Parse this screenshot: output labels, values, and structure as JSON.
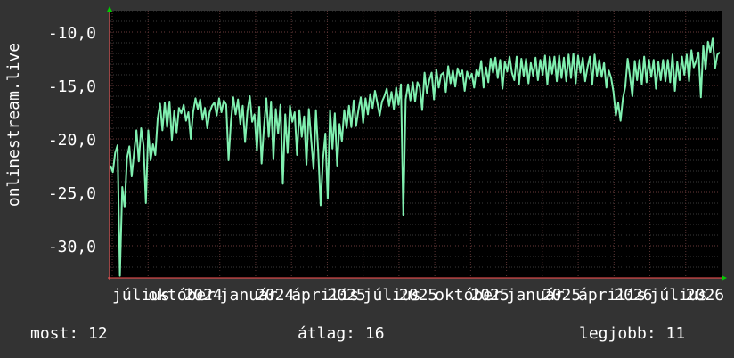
{
  "chart_data": {
    "type": "line",
    "ylabel": "onlinestream.live",
    "ylim": [
      -33,
      -8
    ],
    "yticks": [
      -10,
      -15,
      -20,
      -25,
      -30
    ],
    "ytick_labels": [
      "-10,0",
      "-15,0",
      "-20,0",
      "-25,0",
      "-30,0"
    ],
    "xtick_labels": [
      "július",
      "október",
      "2024",
      "január",
      "2024",
      "április",
      "2025",
      "július",
      "2025",
      "október",
      "2025",
      "január",
      "2025",
      "április",
      "2026",
      "július",
      "2026"
    ],
    "grid": true,
    "series": [
      {
        "color": "#80f0b0",
        "values": [
          -22.5,
          -23.1,
          -21.3,
          -20.6,
          -32.8,
          -24.5,
          -26.4,
          -21.8,
          -20.7,
          -23.5,
          -21.3,
          -19.2,
          -22.1,
          -19.0,
          -20.6,
          -26.0,
          -19.2,
          -22.0,
          -20.5,
          -21.5,
          -18.1,
          -16.7,
          -19.2,
          -16.6,
          -18.9,
          -16.5,
          -20.1,
          -17.4,
          -19.4,
          -17.1,
          -17.6,
          -16.8,
          -18.3,
          -17.5,
          -20.0,
          -17.5,
          -16.2,
          -17.2,
          -16.3,
          -18.2,
          -17.1,
          -19.0,
          -17.5,
          -16.9,
          -16.6,
          -17.8,
          -16.2,
          -17.5,
          -16.4,
          -16.8,
          -22.0,
          -18.4,
          -16.1,
          -17.7,
          -16.3,
          -18.6,
          -16.9,
          -20.3,
          -17.4,
          -16.0,
          -18.4,
          -17.7,
          -21.1,
          -17.0,
          -22.3,
          -18.9,
          -16.2,
          -19.8,
          -16.5,
          -21.9,
          -17.2,
          -19.5,
          -16.8,
          -24.2,
          -17.7,
          -21.3,
          -16.9,
          -18.4,
          -17.5,
          -21.5,
          -17.3,
          -19.8,
          -17.9,
          -22.4,
          -17.2,
          -20.1,
          -22.8,
          -17.3,
          -21.3,
          -26.2,
          -21.9,
          -19.5,
          -25.6,
          -17.3,
          -20.9,
          -17.6,
          -22.5,
          -18.6,
          -20.2,
          -17.3,
          -19.0,
          -16.9,
          -18.9,
          -16.4,
          -18.8,
          -17.3,
          -16.1,
          -18.5,
          -16.2,
          -17.7,
          -15.8,
          -17.1,
          -15.5,
          -16.6,
          -17.8,
          -16.5,
          -16.0,
          -15.3,
          -16.9,
          -15.6,
          -17.2,
          -15.2,
          -16.8,
          -14.9,
          -27.1,
          -16.3,
          -14.9,
          -16.4,
          -14.7,
          -16.5,
          -14.7,
          -15.2,
          -17.3,
          -13.8,
          -15.7,
          -14.5,
          -13.8,
          -16.3,
          -13.5,
          -15.2,
          -14.0,
          -13.8,
          -15.6,
          -13.2,
          -14.8,
          -13.6,
          -15.1,
          -13.4,
          -14.1,
          -13.6,
          -15.5,
          -13.7,
          -14.4,
          -13.9,
          -15.2,
          -13.5,
          -14.1,
          -12.7,
          -15.2,
          -13.3,
          -14.7,
          -12.5,
          -13.8,
          -12.4,
          -14.3,
          -12.6,
          -15.3,
          -12.8,
          -13.7,
          -12.3,
          -13.8,
          -14.5,
          -12.3,
          -14.9,
          -12.5,
          -14.1,
          -12.5,
          -14.8,
          -12.9,
          -14.1,
          -12.4,
          -14.5,
          -12.6,
          -14.0,
          -12.2,
          -14.9,
          -12.3,
          -13.9,
          -12.3,
          -14.6,
          -12.2,
          -14.3,
          -12.4,
          -14.6,
          -12.1,
          -14.3,
          -12.0,
          -14.8,
          -12.2,
          -13.8,
          -12.4,
          -14.6,
          -13.3,
          -12.3,
          -14.9,
          -12.1,
          -14.1,
          -12.6,
          -14.2,
          -12.9,
          -15.2,
          -13.6,
          -14.3,
          -15.6,
          -17.8,
          -16.6,
          -18.3,
          -16.2,
          -15.1,
          -12.5,
          -14.2,
          -16.0,
          -12.7,
          -14.5,
          -12.6,
          -14.9,
          -12.3,
          -14.7,
          -12.6,
          -14.2,
          -12.6,
          -15.3,
          -12.8,
          -14.5,
          -12.6,
          -14.6,
          -12.6,
          -14.7,
          -12.1,
          -15.5,
          -12.8,
          -14.5,
          -12.3,
          -14.0,
          -12.1,
          -14.6,
          -11.7,
          -13.3,
          -12.7,
          -11.9,
          -16.1,
          -11.3,
          -13.5,
          -10.9,
          -11.9,
          -10.6,
          -13.4,
          -12.1,
          -11.9
        ]
      }
    ]
  },
  "footer": {
    "now": {
      "label": "most:",
      "value": "12"
    },
    "avg": {
      "label": "átlag:",
      "value": "16"
    },
    "best": {
      "label": "legjobb:",
      "value": "11"
    }
  }
}
